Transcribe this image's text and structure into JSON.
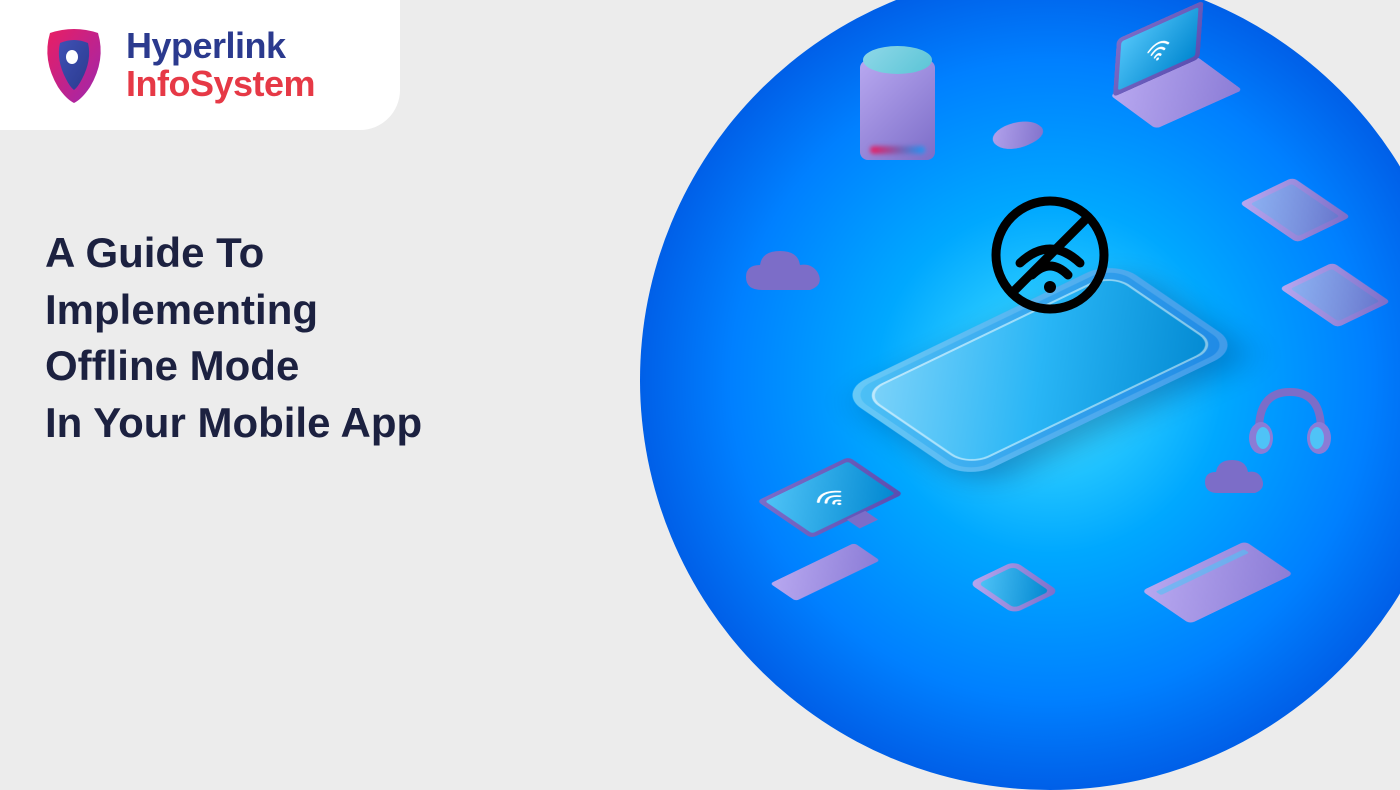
{
  "logo": {
    "line1": "Hyperlink",
    "line2": "InfoSystem"
  },
  "headline": {
    "line1": "A Guide To",
    "line2": "Implementing",
    "line3": "Offline Mode",
    "line4": "In Your Mobile App"
  },
  "colors": {
    "background": "#ECECEC",
    "headline": "#1C2140",
    "logo_primary": "#2B3A8E",
    "logo_secondary": "#E63946",
    "circle_gradient_center": "#48E4FF",
    "circle_gradient_edge": "#2238B8",
    "device_primary": "#7C6DC8",
    "device_light": "#B8A8F0",
    "screen_blue": "#4FC3F7"
  },
  "icons": {
    "no_signal": "prohibited-wifi-icon",
    "laptop_screen": "wifi-icon",
    "monitor_screen": "wifi-icon"
  }
}
